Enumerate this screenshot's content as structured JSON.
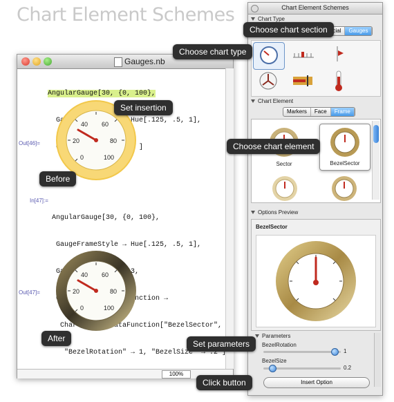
{
  "heading": "Chart Element Schemes",
  "notebook": {
    "title": "Gauges.nb",
    "zoom": "100%",
    "input1_lines": [
      "AngularGauge[30, {0, 100},",
      "  GaugeFrameStyle → Hue[.125, .5, 1],",
      "  GaugeFrameSize → .3 ]"
    ],
    "input1_highlight": "AngularGauge[30, {0, 100},",
    "out1_label": "Out[46]=",
    "in2_label": "In[47]:=",
    "input2_lines": [
      "AngularGauge[30, {0, 100},",
      " GaugeFrameStyle → Hue[.125, .5, 1],",
      " GaugeFrameSize → .3,",
      " GaugeFrameElementFunction →",
      "  ChartElementDataFunction[\"BezelSector\",",
      "   \"BezelRotation\" → 1, \"BezelSize\" → .2`]]"
    ],
    "out2_label": "Out[47]=",
    "gauge_value": 30,
    "gauge_range": [
      0,
      100
    ],
    "gauge_ticks": [
      "0",
      "20",
      "40",
      "60",
      "80",
      "100"
    ]
  },
  "callouts": {
    "choose_section": "Choose chart section",
    "choose_type": "Choose chart type",
    "set_insertion": "Set insertion",
    "choose_element": "Choose chart element",
    "before": "Before",
    "after": "After",
    "set_parameters": "Set parameters",
    "click_button": "Click button"
  },
  "palette": {
    "title": "Chart Element Schemes",
    "chart_type_header": "Chart Type",
    "section_tabs": [
      "ncial",
      "Gauges"
    ],
    "section_selected": "Gauges",
    "chart_element_header": "Chart Element",
    "element_tabs": [
      "Markers",
      "Face",
      "Frame"
    ],
    "element_selected": "Frame",
    "element_items": [
      "Sector",
      "BezelSector"
    ],
    "options_header": "Options Preview",
    "preview_title": "BezelSector",
    "parameters_header": "Parameters",
    "param1_label": "BezelRotation",
    "param1_value": "1",
    "param2_label": "BezelSize",
    "param2_value": "0.2",
    "insert_button": "Insert Option"
  },
  "colors": {
    "frame_gold": "#f2c84b",
    "bezel_dark": "#3a3426",
    "needle": "#c02a1f",
    "selected_tab": "#4a9be8"
  }
}
